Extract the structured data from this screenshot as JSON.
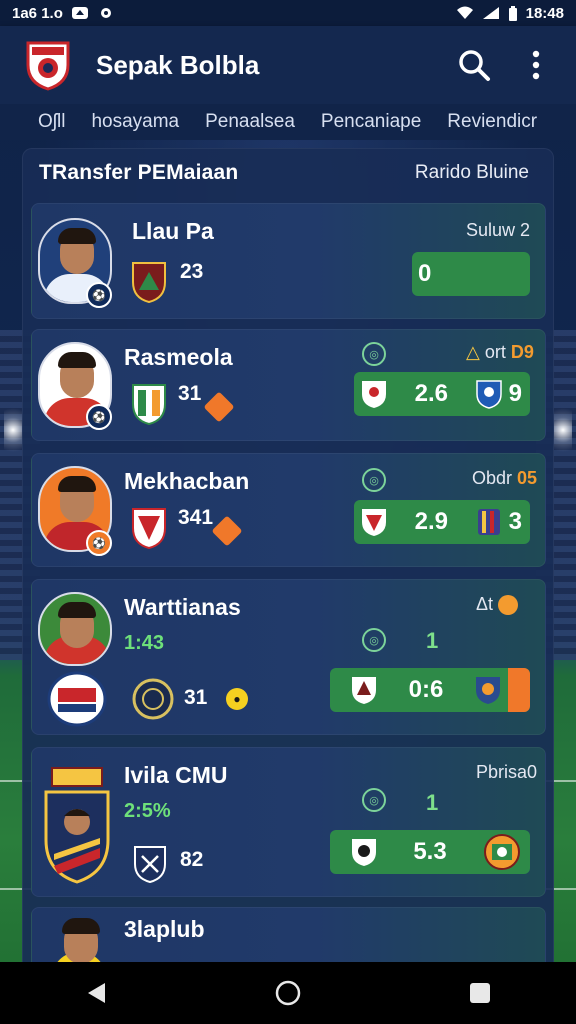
{
  "status_bar": {
    "left_time": "1a6 1.o",
    "right_time": "18:48"
  },
  "app_bar": {
    "title": "Sepak Bolbla",
    "icons": [
      "team-crest-logo",
      "search-icon",
      "more-vert-icon"
    ]
  },
  "tabs": [
    "Oʃll",
    "hosayama",
    "Penaalsea",
    "Pencaniape",
    "Reviendicr"
  ],
  "panel": {
    "title": "TRansfer PEMaiaan",
    "right_label": "Rarido Bluine"
  },
  "players": [
    {
      "name": "Llau Pa",
      "number": "23",
      "right_label": "Suluw 2",
      "box_value": "0"
    },
    {
      "name": "Rasmeola",
      "number": "31",
      "right_label_prefix": "ort",
      "right_label_highlight": "D9",
      "box_value": "2.6",
      "box_right_value": "9"
    },
    {
      "name": "Mekhacban",
      "number": "341",
      "right_label_prefix": "Obdr",
      "right_label_highlight": "05",
      "box_value": "2.9",
      "box_right_value": "3"
    },
    {
      "name": "Warttianas",
      "percent": "1:43",
      "number": "31",
      "right_label": "Δt",
      "one_value": "1",
      "box_value": "0:6"
    },
    {
      "name": "Ivila CMU",
      "percent": "2:5%",
      "number": "82",
      "right_label": "Pbrisa0",
      "one_value": "1",
      "box_value": "5.3"
    },
    {
      "name": "3laplub"
    }
  ],
  "nav_bar": [
    "back-icon",
    "home-icon",
    "recents-icon"
  ],
  "colors": {
    "background": "#0b1a35",
    "app_bar": "#14284f",
    "panel": "#182c56",
    "green_box": "#2e8a48",
    "highlight_orange": "#f39b2f",
    "percent_green": "#6ee07a"
  }
}
